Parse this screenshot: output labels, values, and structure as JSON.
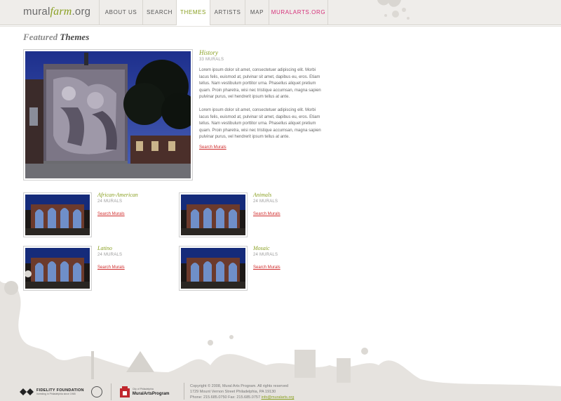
{
  "logo": {
    "part1": "mural",
    "part2": "farm",
    "part3": ".org"
  },
  "nav": [
    {
      "label": "ABOUT US"
    },
    {
      "label": "SEARCH"
    },
    {
      "label": "THEMES"
    },
    {
      "label": "ARTISTS"
    },
    {
      "label": "MAP"
    },
    {
      "label": "MURALARTS.ORG"
    }
  ],
  "page_heading": {
    "light": "Featured",
    "strong": "Themes"
  },
  "featured": {
    "title": "History",
    "count": "33 MURALS",
    "paragraph1": "Lorem ipsum dolor sit amet, consectetuer adipiscing elit. Morbi lacus felis, euismod at, pulvinar sit amet, dapibus eu, eros. Etiam tellus. Nam vestibulum porttitor urna. Phasellus aliquet pretium quam. Proin pharetra, wisi nec tristique accumsan, magna sapien pulvinar purus, vel hendrerit ipsum tellus at ante.",
    "paragraph2": "Lorem ipsum dolor sit amet, consectetuer adipiscing elit. Morbi lacus felis, euismod at, pulvinar sit amet, dapibus eu, eros. Etiam tellus. Nam vestibulum porttitor urna. Phasellus aliquet pretium quam. Proin pharetra, wisi nec tristique accumsan, magna sapien pulvinar purus, vel hendrerit ipsum tellus at ante.",
    "link": "Search Murals"
  },
  "themes": [
    {
      "title": "African-American",
      "count": "24 MURALS",
      "link": "Search Murals"
    },
    {
      "title": "Animals",
      "count": "24 MURALS",
      "link": "Search Murals"
    },
    {
      "title": "Latino",
      "count": "24 MURALS",
      "link": "Search Murals"
    },
    {
      "title": "Mosaic",
      "count": "24 MURALS",
      "link": "Search Murals"
    }
  ],
  "footer": {
    "fidelity": "FIDELITY FOUNDATION",
    "fidelity_sub": "Investing in Philadelphia since 1965",
    "city_line": "City of Philadelphia",
    "map": "MuralArtsProgram",
    "copyright": "Copyright © 2008, Mural Arts Program. All rights reserved",
    "address": "1729 Mount Vernon Street Philadelphia, PA 19130",
    "contact": "Phone: 215.685.0750   Fax: 215.685.0757",
    "email": "info@muralarts.org"
  },
  "colors": {
    "accent_green": "#8aa022",
    "link_red": "#d02d2d",
    "nav_pink": "#d5317a",
    "header_bg": "#efedea"
  }
}
